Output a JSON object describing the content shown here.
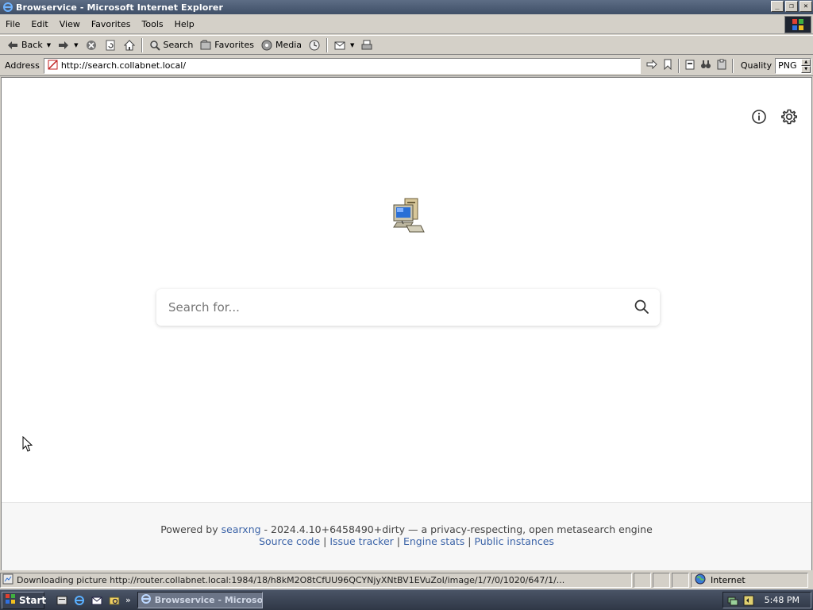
{
  "window": {
    "title": "Browservice - Microsoft Internet Explorer",
    "buttons": {
      "minimize": "_",
      "restore": "❐",
      "close": "✕"
    }
  },
  "menu": [
    "File",
    "Edit",
    "View",
    "Favorites",
    "Tools",
    "Help"
  ],
  "toolbar": {
    "back_label": "Back",
    "search_label": "Search",
    "favorites_label": "Favorites",
    "media_label": "Media"
  },
  "address": {
    "label": "Address",
    "url": "http://search.collabnet.local/",
    "quality_label": "Quality",
    "quality_value": "PNG"
  },
  "page": {
    "search_placeholder": "Search for...",
    "footer": {
      "powered_by": "Powered by",
      "searxng_link": "searxng",
      "version_text": " - 2024.4.10+6458490+dirty — a privacy-respecting, open metasearch engine",
      "links": [
        "Source code",
        "Issue tracker",
        "Engine stats",
        "Public instances"
      ],
      "separator": " | "
    }
  },
  "status": {
    "text": "Downloading picture http://router.collabnet.local:1984/18/h8kM2O8tCfUU96QCYNjyXNtBV1EVuZoI/image/1/7/0/1020/647/1/...",
    "zone": "Internet"
  },
  "taskbar": {
    "start_label": "Start",
    "more_label": "»",
    "task_label": "Browservice - Microso...",
    "clock": "5:48 PM"
  },
  "colors": {
    "link": "#3c64a8",
    "titlebar": "#4d5d75",
    "chrome": "#d4d0c8",
    "footer_bg": "#f7f7f7"
  },
  "icons": [
    "ie-icon",
    "back-arrow-icon",
    "forward-arrow-icon",
    "stop-icon",
    "refresh-icon",
    "home-icon",
    "search-icon",
    "favorites-icon",
    "media-icon",
    "history-icon",
    "mail-icon",
    "print-icon",
    "go-arrow-icon",
    "bookmark-icon",
    "info-icon",
    "gear-icon",
    "computer-logo-icon",
    "magnifier-icon"
  ]
}
